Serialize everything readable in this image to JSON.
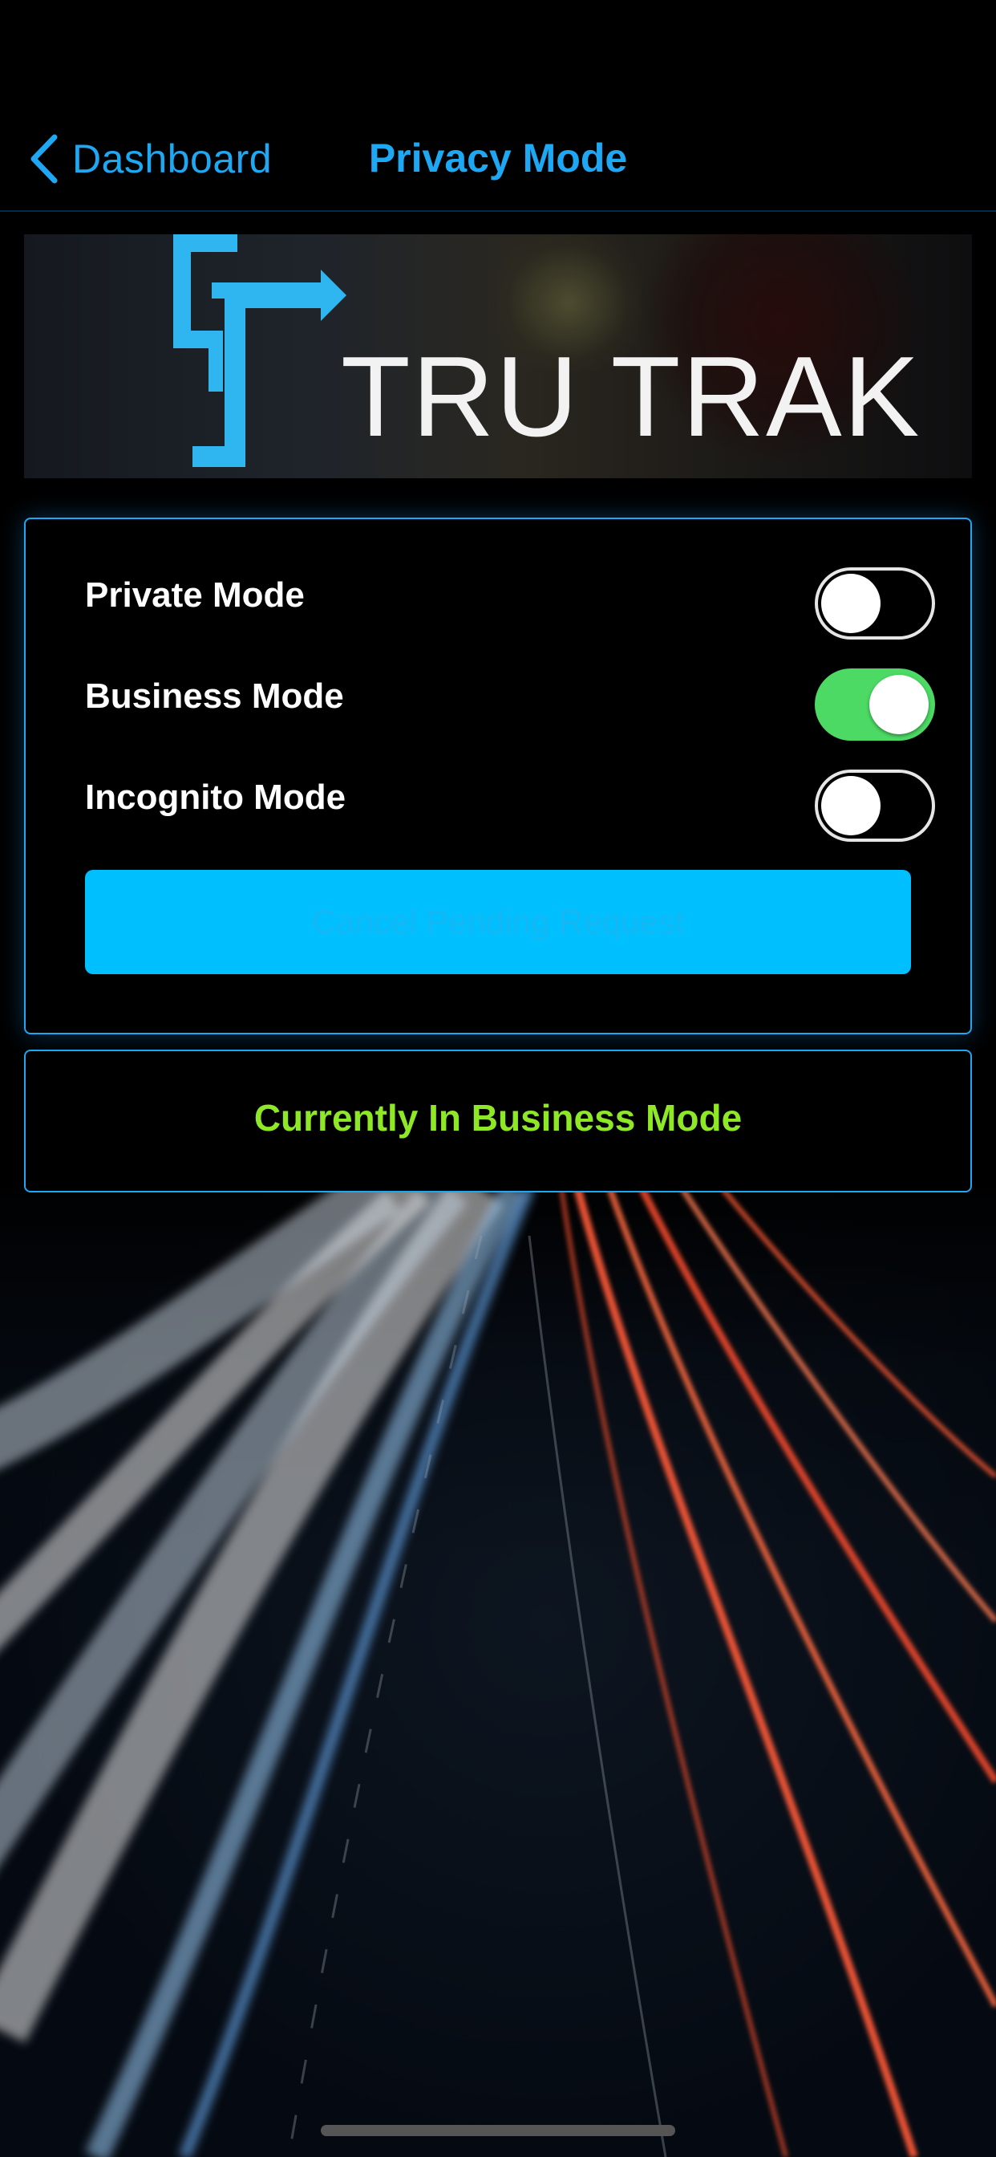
{
  "nav": {
    "back_label": "Dashboard",
    "title": "Privacy Mode"
  },
  "banner": {
    "brand_text": "TRU TRAK",
    "logo_icon": "tru-trak-logo-icon"
  },
  "modes": [
    {
      "label": "Private Mode",
      "on": false
    },
    {
      "label": "Business Mode",
      "on": true
    },
    {
      "label": "Incognito Mode",
      "on": false
    }
  ],
  "cancel_button": {
    "label": "Cancel Pending Request"
  },
  "status": {
    "text": "Currently In Business Mode"
  },
  "colors": {
    "accent": "#1ea7f3",
    "toggle_on": "#4cd964",
    "button": "#00bfff",
    "status_text": "#8fe826"
  }
}
